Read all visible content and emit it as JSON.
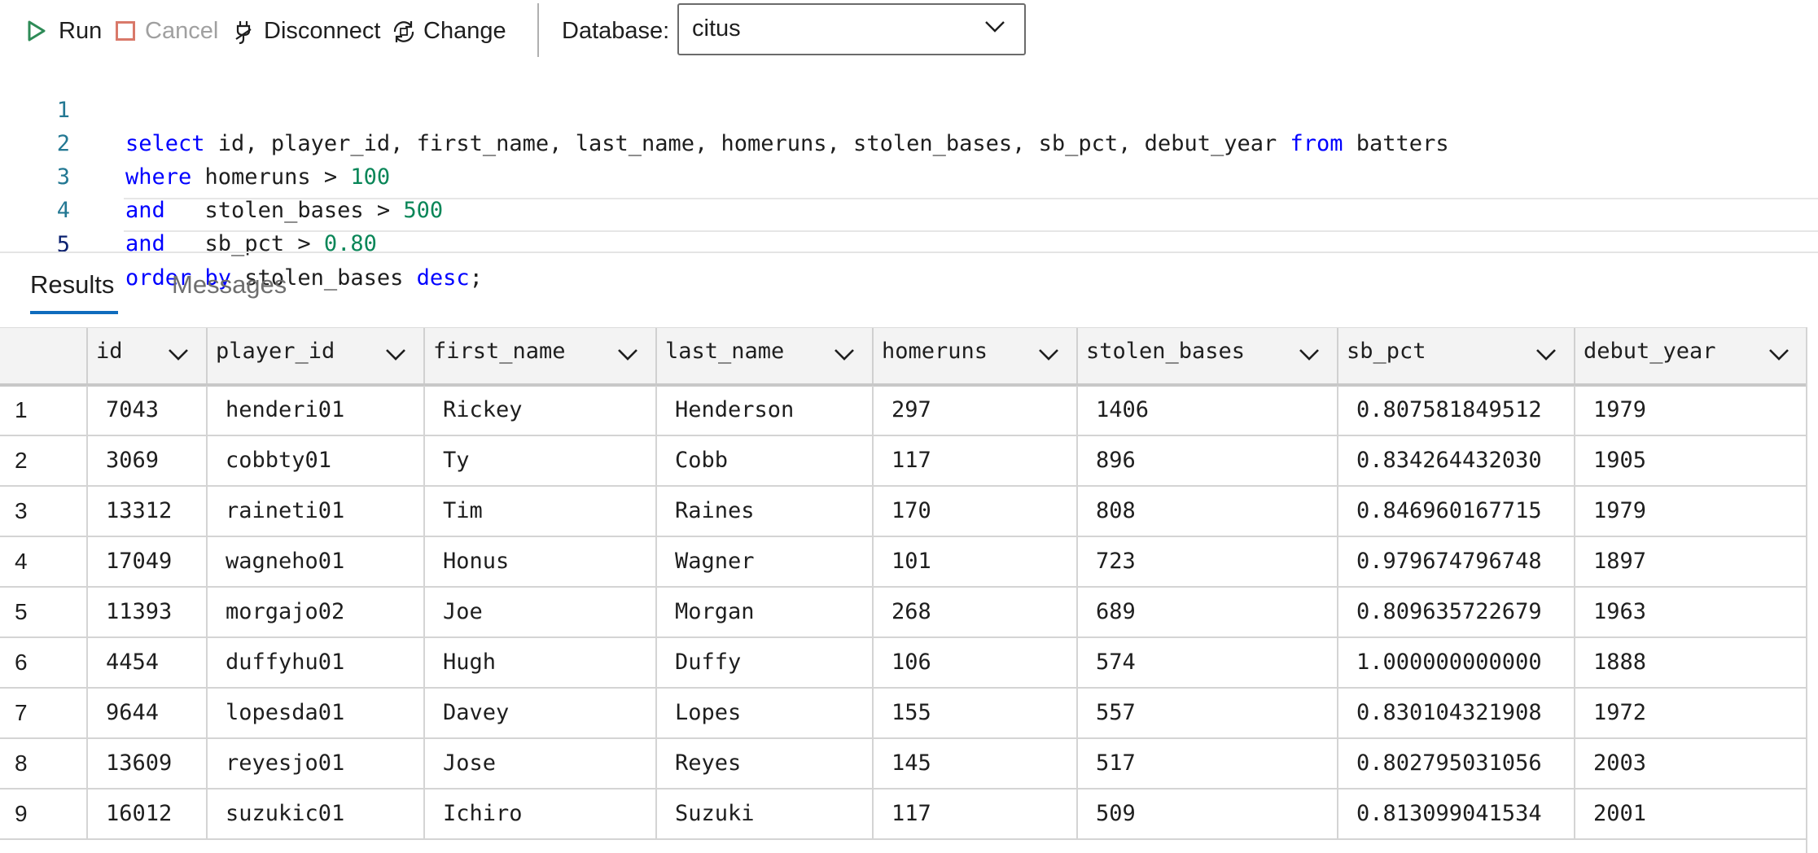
{
  "toolbar": {
    "run": "Run",
    "cancel": "Cancel",
    "disconnect": "Disconnect",
    "change": "Change",
    "database_label": "Database:",
    "database_value": "citus"
  },
  "editor": {
    "lines": [
      {
        "n": "1"
      },
      {
        "n": "2"
      },
      {
        "n": "3"
      },
      {
        "n": "4"
      },
      {
        "n": "5"
      }
    ],
    "code": [
      [
        {
          "k": "kw",
          "t": "select"
        },
        {
          "k": "",
          "t": " id, player_id, first_name, last_name, homeruns, stolen_bases, sb_pct, debut_year "
        },
        {
          "k": "kw",
          "t": "from"
        },
        {
          "k": "",
          "t": " batters"
        }
      ],
      [
        {
          "k": "kw",
          "t": "where"
        },
        {
          "k": "",
          "t": " homeruns > "
        },
        {
          "k": "num",
          "t": "100"
        }
      ],
      [
        {
          "k": "kw",
          "t": "and"
        },
        {
          "k": "",
          "t": "   stolen_bases > "
        },
        {
          "k": "num",
          "t": "500"
        }
      ],
      [
        {
          "k": "kw",
          "t": "and"
        },
        {
          "k": "",
          "t": "   sb_pct > "
        },
        {
          "k": "num",
          "t": "0.80"
        }
      ],
      [
        {
          "k": "kw",
          "t": "order by"
        },
        {
          "k": "",
          "t": " stolen_bases "
        },
        {
          "k": "kw",
          "t": "desc"
        },
        {
          "k": "",
          "t": ";"
        }
      ]
    ]
  },
  "tabs": {
    "results": "Results",
    "messages": "Messages"
  },
  "grid": {
    "columns": [
      "id",
      "player_id",
      "first_name",
      "last_name",
      "homeruns",
      "stolen_bases",
      "sb_pct",
      "debut_year"
    ],
    "rows": [
      [
        "1",
        "7043",
        "henderi01",
        "Rickey",
        "Henderson",
        "297",
        "1406",
        "0.807581849512",
        "1979"
      ],
      [
        "2",
        "3069",
        "cobbty01",
        "Ty",
        "Cobb",
        "117",
        "896",
        "0.834264432030",
        "1905"
      ],
      [
        "3",
        "13312",
        "raineti01",
        "Tim",
        "Raines",
        "170",
        "808",
        "0.846960167715",
        "1979"
      ],
      [
        "4",
        "17049",
        "wagneho01",
        "Honus",
        "Wagner",
        "101",
        "723",
        "0.979674796748",
        "1897"
      ],
      [
        "5",
        "11393",
        "morgajo02",
        "Joe",
        "Morgan",
        "268",
        "689",
        "0.809635722679",
        "1963"
      ],
      [
        "6",
        "4454",
        "duffyhu01",
        "Hugh",
        "Duffy",
        "106",
        "574",
        "1.000000000000",
        "1888"
      ],
      [
        "7",
        "9644",
        "lopesda01",
        "Davey",
        "Lopes",
        "155",
        "557",
        "0.830104321908",
        "1972"
      ],
      [
        "8",
        "13609",
        "reyesjo01",
        "Jose",
        "Reyes",
        "145",
        "517",
        "0.802795031056",
        "2003"
      ],
      [
        "9",
        "16012",
        "suzukic01",
        "Ichiro",
        "Suzuki",
        "117",
        "509",
        "0.813099041534",
        "2001"
      ]
    ]
  },
  "colors": {
    "keyword": "#0000ff",
    "number": "#098658",
    "line_number": "#237893",
    "tab_underline": "#0f6cbd",
    "run_icon": "#2e8b57",
    "cancel_icon": "#d9796a"
  }
}
